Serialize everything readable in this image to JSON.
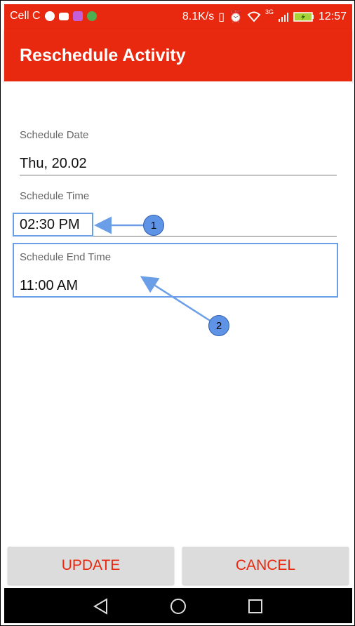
{
  "status_bar": {
    "carrier": "Cell C",
    "speed": "8.1K/s",
    "network": "3G",
    "time": "12:57",
    "icons": [
      "whatsapp-icon",
      "mail-icon",
      "app-icon",
      "globe-icon",
      "vibrate-icon",
      "alarm-icon",
      "wifi-icon",
      "signal-icon",
      "battery-icon"
    ]
  },
  "app_bar": {
    "title": "Reschedule Activity",
    "color": "#e8280f"
  },
  "form": {
    "schedule_date": {
      "label": "Schedule Date",
      "value": "Thu, 20.02"
    },
    "schedule_time": {
      "label": "Schedule Time",
      "value": "02:30 PM"
    },
    "schedule_end_time": {
      "label": "Schedule End Time",
      "value": "11:00 AM"
    }
  },
  "annotations": [
    {
      "number": "1"
    },
    {
      "number": "2"
    }
  ],
  "buttons": {
    "update": "UPDATE",
    "cancel": "CANCEL"
  },
  "nav_bar": {
    "icons": [
      "back-icon",
      "home-icon",
      "recents-icon"
    ]
  },
  "colors": {
    "accent": "#e8280f",
    "annotation": "#6a9fe8",
    "button_bg": "#dcdcdc"
  }
}
